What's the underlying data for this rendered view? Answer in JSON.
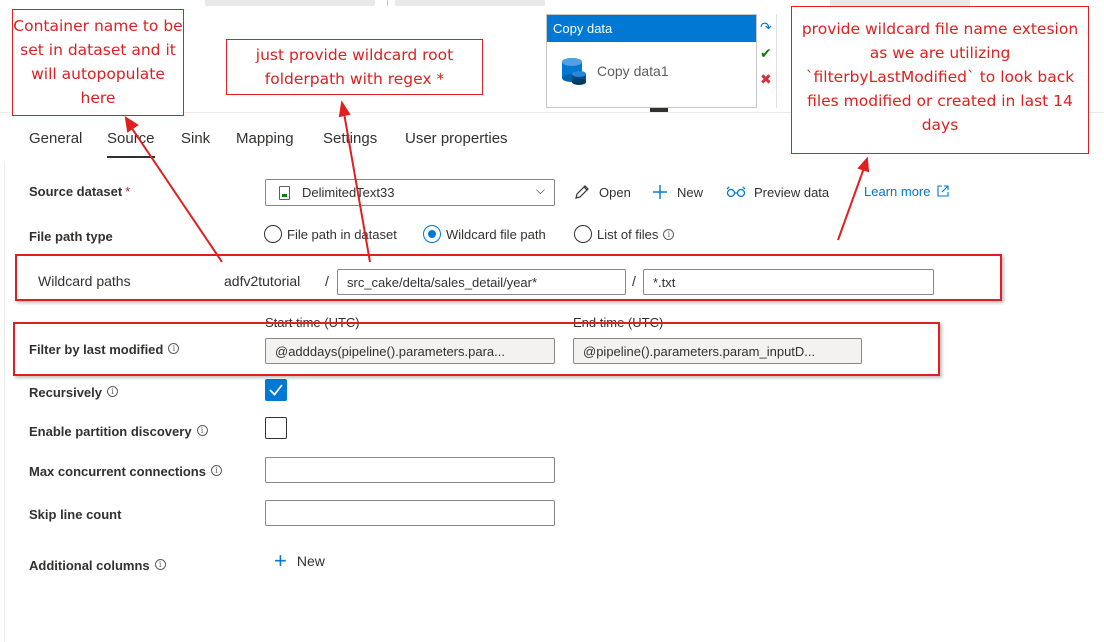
{
  "canvas": {
    "activity_type": "Copy data",
    "activity_name": "Copy data1"
  },
  "tabs": [
    {
      "label": "General"
    },
    {
      "label": "Source"
    },
    {
      "label": "Sink"
    },
    {
      "label": "Mapping"
    },
    {
      "label": "Settings"
    },
    {
      "label": "User properties"
    }
  ],
  "active_tab": "Source",
  "source_dataset": {
    "label": "Source dataset",
    "required_marker": "*",
    "value": "DelimitedText33",
    "open_label": "Open",
    "new_label": "New",
    "preview_label": "Preview data",
    "learn_more_label": "Learn more"
  },
  "file_path_type": {
    "label": "File path type",
    "options": [
      "File path in dataset",
      "Wildcard file path",
      "List of files"
    ],
    "selected": "Wildcard file path"
  },
  "wildcard_paths": {
    "label": "Wildcard paths",
    "container": "adfv2tutorial",
    "separator": "/",
    "folder_path": "src_cake/delta/sales_detail/year*",
    "file_name": "*.txt"
  },
  "filter_last_modified": {
    "label": "Filter by last modified",
    "start_header": "Start time (UTC)",
    "end_header": "End time (UTC)",
    "start_value": "@adddays(pipeline().parameters.para...",
    "end_value": "@pipeline().parameters.param_inputD..."
  },
  "recursively": {
    "label": "Recursively",
    "checked": true
  },
  "partition_discovery": {
    "label": "Enable partition discovery",
    "checked": false
  },
  "max_connections": {
    "label": "Max concurrent connections",
    "value": ""
  },
  "skip_line_count": {
    "label": "Skip line count",
    "value": ""
  },
  "additional_columns": {
    "label": "Additional columns",
    "new_label": "New"
  },
  "annotations": {
    "container_note": "Container name to be set in dataset and it will autopopulate here",
    "folder_note": "just provide wildcard root folderpath with regex *",
    "file_note": "provide wildcard file name extesion as we are utilizing `filterbyLastModified` to look back files modified or created in last 14 days"
  },
  "colors": {
    "accent": "#0078d4",
    "annotation": "#e02020"
  }
}
